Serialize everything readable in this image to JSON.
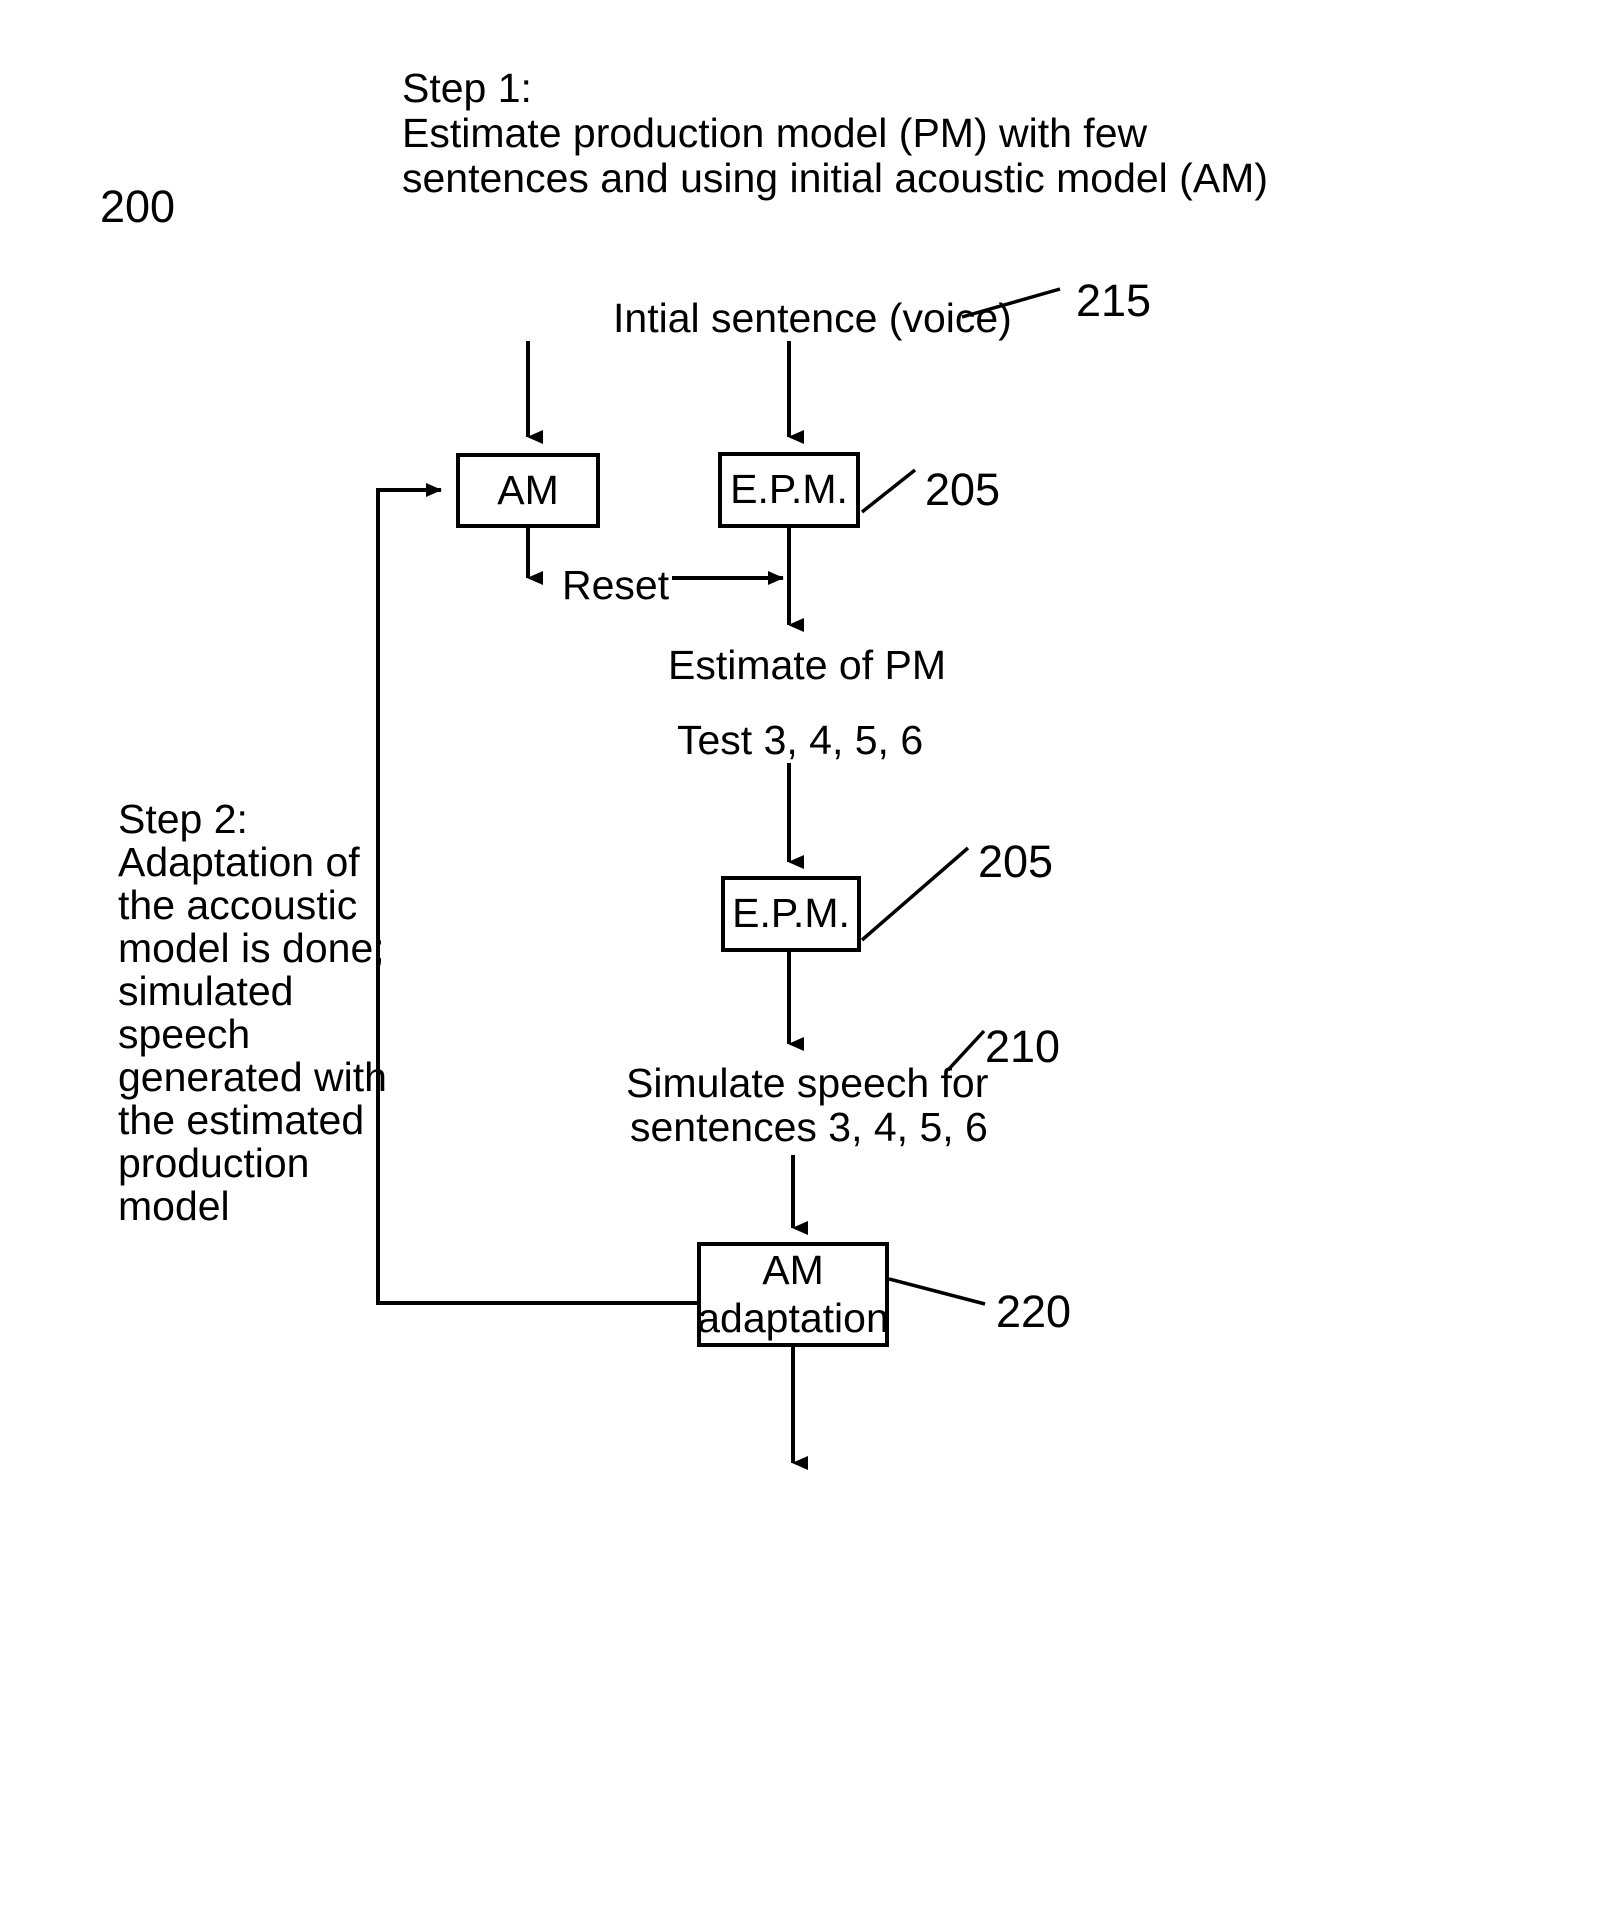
{
  "figure": {
    "number": "200"
  },
  "annotations": {
    "step1": {
      "title": "Step 1:",
      "line1": "Estimate production model (PM) with few",
      "line2": "sentences and using initial acoustic model (AM)"
    },
    "step2": {
      "title": "Step 2:",
      "line1": "Adaptation of",
      "line2": "the accoustic",
      "line3": "model is done;",
      "line4": "simulated",
      "line5": "speech",
      "line6": "generated with",
      "line7": "the estimated",
      "line8": "production",
      "line9": "model"
    }
  },
  "labels": {
    "initial_sentence": "Intial sentence (voice)",
    "reset": "Reset",
    "estimate_of_pm": "Estimate of PM",
    "test_sentences": "Test 3, 4, 5, 6",
    "simulate_line1": "Simulate speech for",
    "simulate_line2": "sentences 3, 4, 5, 6"
  },
  "boxes": {
    "am": "AM",
    "epm_top": "E.P.M.",
    "epm_bottom": "E.P.M.",
    "am_adaptation_line1": "AM",
    "am_adaptation_line2": "adaptation"
  },
  "refs": {
    "r215": "215",
    "r205_top": "205",
    "r205_bottom": "205",
    "r210": "210",
    "r220": "220"
  },
  "style": {
    "stroke": "#000000",
    "background": "#ffffff"
  }
}
